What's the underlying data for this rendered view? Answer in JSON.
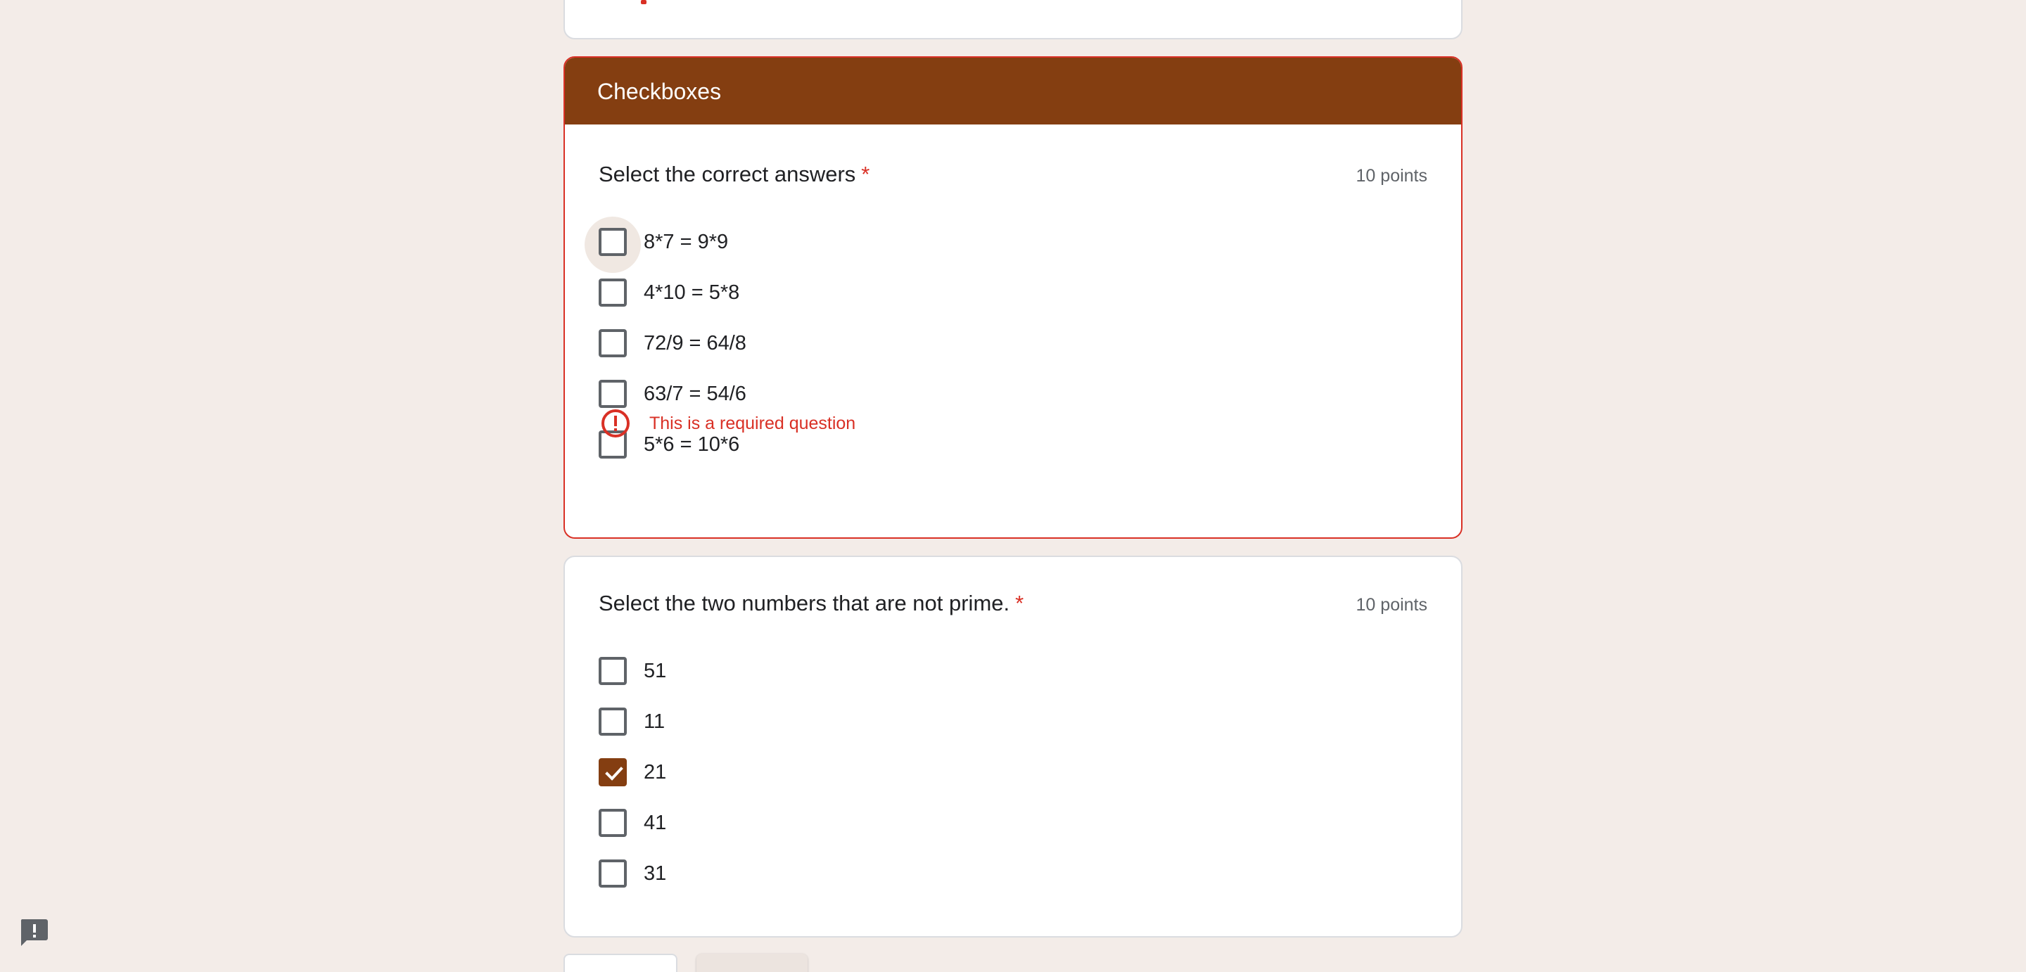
{
  "section": {
    "title": "Checkboxes"
  },
  "question1": {
    "title": "Select the correct answers",
    "required_marker": "*",
    "points": "10 points",
    "options": [
      {
        "label": "8*7 = 9*9",
        "checked": false
      },
      {
        "label": "4*10 = 5*8",
        "checked": false
      },
      {
        "label": "72/9 = 64/8",
        "checked": false
      },
      {
        "label": "63/7 = 54/6",
        "checked": false
      },
      {
        "label": "5*6 = 10*6",
        "checked": false
      }
    ],
    "error": "This is a required question"
  },
  "question2": {
    "title": "Select the two numbers that are not prime.",
    "required_marker": "*",
    "points": "10 points",
    "options": [
      {
        "label": "51",
        "checked": false
      },
      {
        "label": "11",
        "checked": false
      },
      {
        "label": "21",
        "checked": true
      },
      {
        "label": "41",
        "checked": false
      },
      {
        "label": "31",
        "checked": false
      }
    ]
  },
  "theme": {
    "accent": "#843e11",
    "error": "#d93025",
    "background": "#f3ece8"
  },
  "icons": {
    "error": "error-circle-icon",
    "check": "check-icon",
    "feedback": "feedback-icon"
  }
}
